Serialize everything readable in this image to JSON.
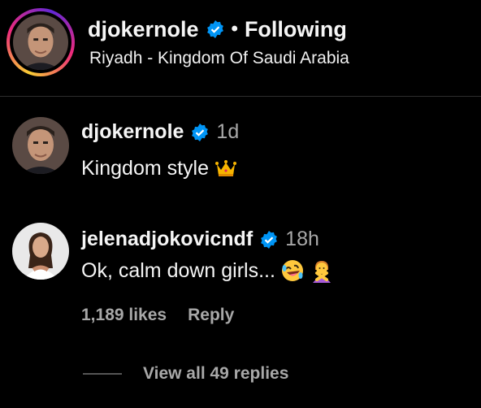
{
  "header": {
    "username": "djokernole",
    "separator": "•",
    "follow_status": "Following",
    "location": "Riyadh - Kingdom Of Saudi Arabia"
  },
  "comments": [
    {
      "username": "djokernole",
      "time": "1d",
      "text": "Kingdom style",
      "emoji": [
        "crown-emoji"
      ]
    },
    {
      "username": "jelenadjokovicndf",
      "time": "18h",
      "text": "Ok, calm down girls...",
      "emoji": [
        "rolling-on-floor-laughing-emoji",
        "person-gesturing-no-emoji"
      ],
      "likes": "1,189 likes",
      "reply_label": "Reply",
      "view_replies": "View all 49 replies"
    }
  ],
  "colors": {
    "background": "#000000",
    "text": "#f5f5f5",
    "muted": "#a8a8a8",
    "verified": "#0095f6"
  }
}
